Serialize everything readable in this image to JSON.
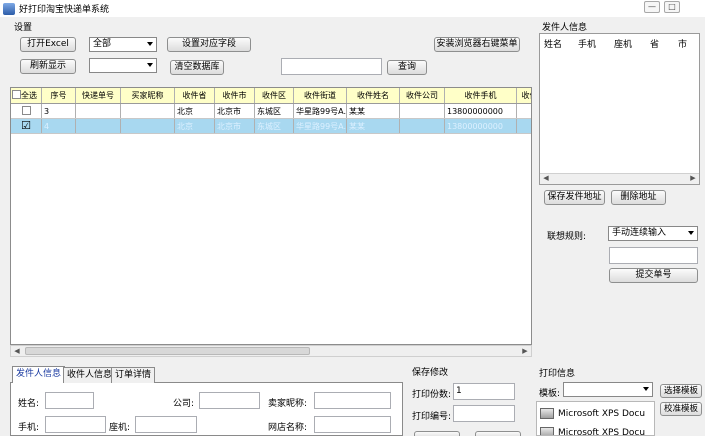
{
  "window": {
    "title": "好打印淘宝快递单系统",
    "min_glyph": "—",
    "max_glyph": "□"
  },
  "settings": {
    "group_label": "设置",
    "open_excel": "打开Excel",
    "refresh": "刷新显示",
    "filter_combo_value": "全部",
    "filter_combo2_value": "",
    "set_fields": "设置对应字段",
    "clear_db": "清空数据库",
    "search_value": "",
    "search_button": "查询",
    "install_menu": "安装浏览器右键菜单"
  },
  "grid": {
    "columns": [
      "全选",
      "序号",
      "快递单号",
      "买家昵称",
      "收件省",
      "收件市",
      "收件区",
      "收件街道",
      "收件姓名",
      "收件公司",
      "收件手机",
      "收件"
    ],
    "rows": [
      {
        "checked": false,
        "cells": [
          "",
          "3",
          "",
          "",
          "北京",
          "北京市",
          "东城区",
          "华星路99号A...",
          "某某",
          "",
          "13800000000",
          ""
        ]
      },
      {
        "checked": true,
        "cells": [
          "",
          "4",
          "",
          "",
          "北京",
          "北京市",
          "东城区",
          "华星路99号A...",
          "某某",
          "",
          "13800000000",
          ""
        ]
      }
    ]
  },
  "sender_list": {
    "title": "发件人信息",
    "columns": [
      "姓名",
      "手机",
      "座机",
      "省",
      "市"
    ],
    "save_button": "保存发件地址",
    "delete_button": "删除地址"
  },
  "association": {
    "label": "联想规则:",
    "value": "手动连续输入",
    "input_value": "",
    "submit_button": "提交单号"
  },
  "tabs": [
    {
      "label": "发件人信息",
      "active": true
    },
    {
      "label": "收件人信息",
      "active": false
    },
    {
      "label": "订单详情",
      "active": false
    }
  ],
  "sender_form": {
    "name_label": "姓名:",
    "company_label": "公司:",
    "nick_label": "卖家昵称:",
    "mobile_label": "手机:",
    "phone_label": "座机:",
    "shop_label": "网店名称:"
  },
  "save_modify": {
    "title": "保存修改",
    "copies_label": "打印份数:",
    "copies_value": "1",
    "number_label": "打印编号:"
  },
  "print_info": {
    "title": "打印信息",
    "template_label": "模板:",
    "template_value": "",
    "choose_button": "选择模板",
    "calibrate_button": "校准模板",
    "printers": [
      "Microsoft XPS Docu",
      "Microsoft XPS Docu"
    ]
  },
  "colors": {
    "header_bg": "#ffffc8",
    "selected_row": "#a8d8f0",
    "tab_active_text": "#1a3aa0"
  }
}
